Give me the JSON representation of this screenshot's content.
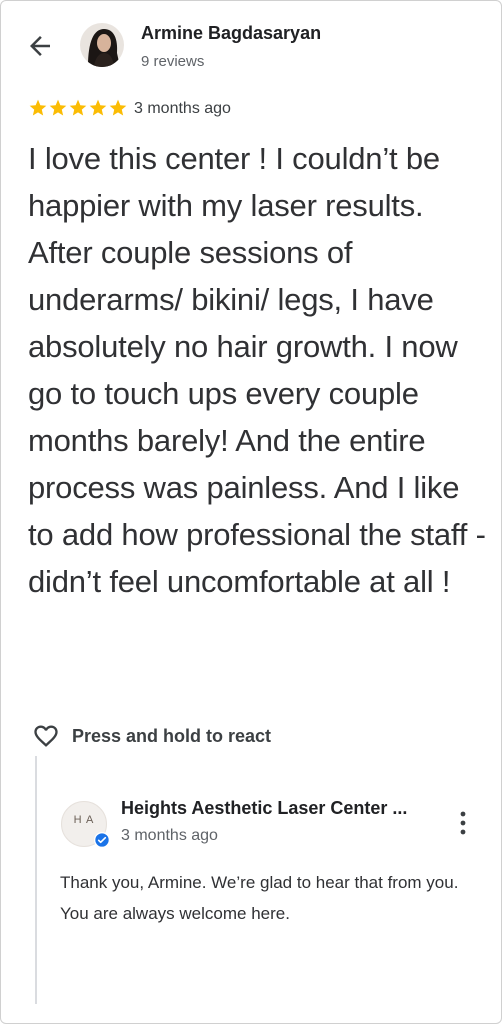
{
  "header": {
    "author_name": "Armine Bagdasaryan",
    "author_meta": "9 reviews",
    "back_icon": "arrow-left-icon",
    "avatar_icon": "user-avatar"
  },
  "review": {
    "rating": 5,
    "rating_max": 5,
    "star_color": "#fbbc04",
    "time": "3 months ago",
    "text": "I love this center ! I couldn’t be happier with my laser results. After couple sessions of underarms/ bikini/ legs, I have absolutely no hair growth. I now go to touch ups every couple months barely! And the entire process was painless. And I like to add how professional the staff - didn’t feel uncomfortable at all !"
  },
  "react": {
    "label": "Press and hold to react",
    "icon": "heart-outline-icon"
  },
  "owner_response": {
    "business_name": "Heights Aesthetic Laser Center ...",
    "logo_text": "H A",
    "time": "3 months ago",
    "verified_color": "#1a73e8",
    "text": "Thank you, Armine. We’re glad to hear that from you. You are always welcome here.",
    "more_icon": "more-vertical-icon"
  }
}
